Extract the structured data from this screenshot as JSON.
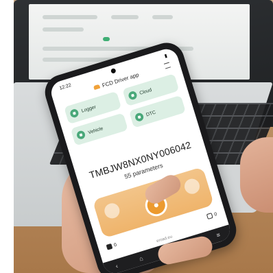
{
  "phone": {
    "status_time": "12:22",
    "app_title": "FCD Driver app",
    "tiles": [
      {
        "label": "Logger",
        "icon": "logger-icon"
      },
      {
        "label": "Cloud",
        "icon": "cloud-icon"
      },
      {
        "label": "Vehicle",
        "icon": "vehicle-icon"
      },
      {
        "label": "DTC",
        "icon": "dtc-icon"
      }
    ],
    "vin": "TMBJW8NX0NY006042",
    "parameters": "55 parameters",
    "bottom_left_count": "0",
    "bottom_right_count": "0",
    "url": "eroad.eu"
  },
  "colors": {
    "tile_bg": "#dcefe4",
    "tile_icon": "#4aa87a",
    "accent_orange": "#ec9a2f",
    "card": "#efb46b"
  }
}
